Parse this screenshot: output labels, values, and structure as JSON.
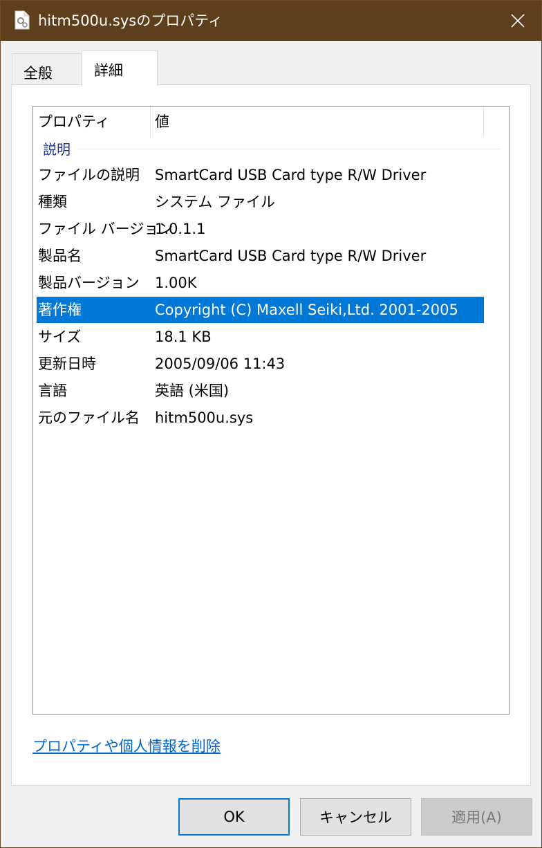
{
  "window": {
    "title": "hitm500u.sysのプロパティ"
  },
  "tabs": [
    {
      "label": "全般"
    },
    {
      "label": "詳細"
    }
  ],
  "list": {
    "columns": {
      "property": "プロパティ",
      "value": "値"
    },
    "group": "説明",
    "rows": [
      {
        "name": "ファイルの説明",
        "value": "SmartCard USB Card type R/W  Driver"
      },
      {
        "name": "種類",
        "value": "システム ファイル"
      },
      {
        "name": "ファイル バージョン",
        "value": "1.0.1.1"
      },
      {
        "name": "製品名",
        "value": "SmartCard USB Card type R/W  Driver"
      },
      {
        "name": "製品バージョン",
        "value": "1.00K"
      },
      {
        "name": "著作権",
        "value": "Copyright (C) Maxell Seiki,Ltd. 2001-2005",
        "selected": true
      },
      {
        "name": "サイズ",
        "value": "18.1 KB"
      },
      {
        "name": "更新日時",
        "value": "2005/09/06 11:43"
      },
      {
        "name": "言語",
        "value": "英語 (米国)"
      },
      {
        "name": "元のファイル名",
        "value": "hitm500u.sys"
      }
    ]
  },
  "link": {
    "remove_properties": "プロパティや個人情報を削除"
  },
  "buttons": {
    "ok": "OK",
    "cancel": "キャンセル",
    "apply": "適用(A)"
  },
  "colors": {
    "titlebar": "#5e3f1c",
    "selection": "#0078d7",
    "group_header": "#1e3287",
    "link": "#0066cc"
  }
}
